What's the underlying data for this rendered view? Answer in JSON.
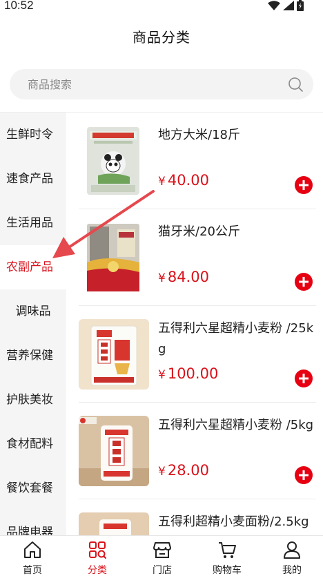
{
  "status": {
    "time": "10:52",
    "icons": [
      "wifi-icon",
      "signal-icon",
      "battery-icon"
    ]
  },
  "header": {
    "title": "商品分类"
  },
  "search": {
    "placeholder": "商品搜索",
    "icon": "search-icon"
  },
  "sidebar": {
    "items": [
      {
        "label": "生鲜时令"
      },
      {
        "label": "速食产品"
      },
      {
        "label": "生活用品"
      },
      {
        "label": "农副产品",
        "active": true
      },
      {
        "label": "调味品"
      },
      {
        "label": "营养保健"
      },
      {
        "label": "护肤美妆"
      },
      {
        "label": "食材配料"
      },
      {
        "label": "餐饮套餐"
      },
      {
        "label": "品牌电器"
      }
    ]
  },
  "products": [
    {
      "name": "地方大米/18斤",
      "currency": "¥",
      "price": "40.00"
    },
    {
      "name": "猫牙米/20公斤",
      "currency": "¥",
      "price": "84.00"
    },
    {
      "name": "五得利六星超精小麦粉 /25kg",
      "currency": "¥",
      "price": "100.00"
    },
    {
      "name": "五得利六星超精小麦粉 /5kg",
      "currency": "¥",
      "price": "28.00"
    },
    {
      "name": "五得利超精小麦面粉/2.5kg",
      "currency": "¥",
      "price": ""
    }
  ],
  "tabbar": {
    "tabs": [
      {
        "label": "首页",
        "icon": "home-icon"
      },
      {
        "label": "分类",
        "icon": "category-icon",
        "active": true
      },
      {
        "label": "门店",
        "icon": "store-icon"
      },
      {
        "label": "购物车",
        "icon": "cart-icon"
      },
      {
        "label": "我的",
        "icon": "user-icon"
      }
    ]
  },
  "colors": {
    "accent": "#d9121b",
    "add_button": "#e60012",
    "sidebar_bg": "#f5f5f5",
    "search_bg": "#f3f3f3",
    "annotation_arrow": "#e5484d"
  }
}
